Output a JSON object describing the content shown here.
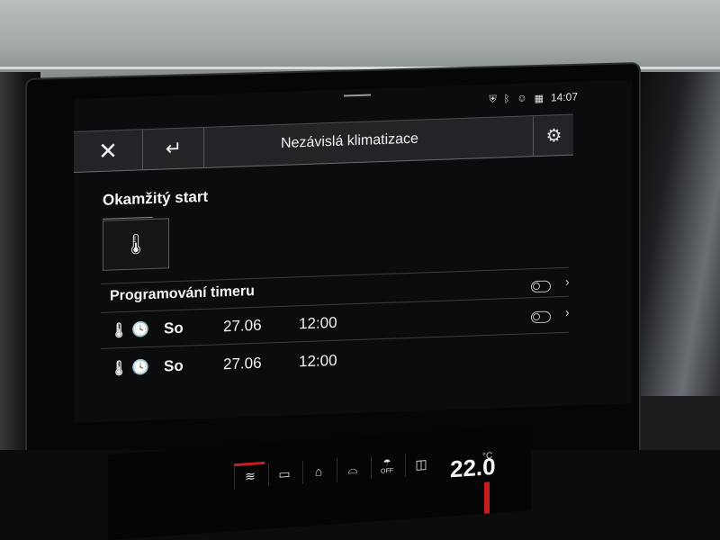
{
  "status": {
    "time": "14:07",
    "icons": [
      "location-shield-icon",
      "bluetooth-icon",
      "person-icon",
      "signal-icon"
    ]
  },
  "header": {
    "close_icon": "✕",
    "back_icon": "↵",
    "title": "Nezávislá klimatizace",
    "settings_icon": "⚙"
  },
  "instant_start": {
    "title": "Okamžitý start",
    "tile_icon": "🌡"
  },
  "timer": {
    "title": "Programování timeru",
    "chevron": "›",
    "rows": [
      {
        "thermo_icon": "🌡",
        "clock_icon": "🕓",
        "day": "So",
        "date": "27.06",
        "time": "12:00"
      },
      {
        "thermo_icon": "🌡",
        "clock_icon": "🕓",
        "day": "So",
        "date": "27.06",
        "time": "12:00"
      }
    ]
  },
  "climate_bar": {
    "temperature": "22.0",
    "unit": "°C",
    "buttons": [
      "seat-heat-icon",
      "rear-heat-icon",
      "recirculation-icon",
      "windshield-icon",
      "windshield-off-icon",
      "rear-window-icon"
    ],
    "off_label": "OFF"
  }
}
